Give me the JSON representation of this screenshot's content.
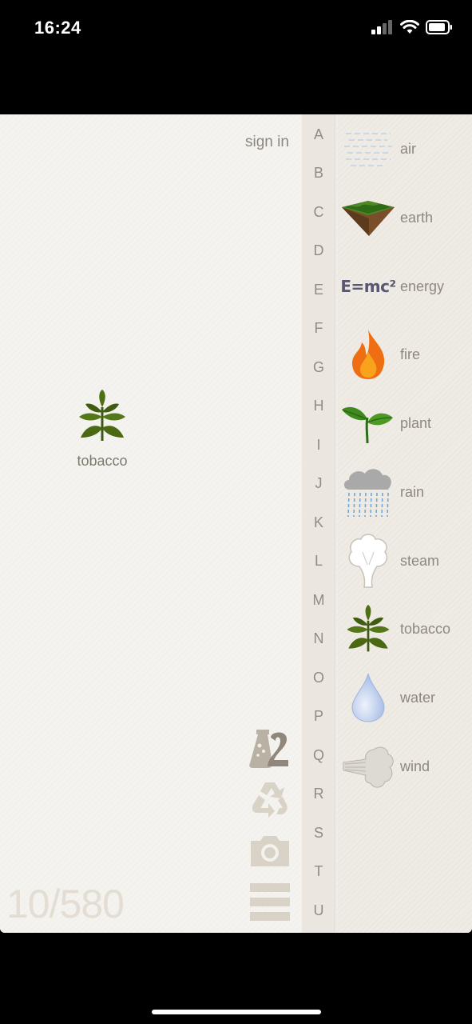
{
  "status_bar": {
    "time": "16:24"
  },
  "header": {
    "sign_in": "sign in"
  },
  "canvas": {
    "items": [
      {
        "label": "tobacco",
        "icon": "tobacco-leaf-icon"
      }
    ]
  },
  "counter": "10/580",
  "tools": [
    "alchemy-2-icon",
    "recycle-icon",
    "camera-icon",
    "menu-icon"
  ],
  "alphabet": [
    "A",
    "B",
    "C",
    "D",
    "E",
    "F",
    "G",
    "H",
    "I",
    "J",
    "K",
    "L",
    "M",
    "N",
    "O",
    "P",
    "Q",
    "R",
    "S",
    "T",
    "U"
  ],
  "elements": [
    {
      "label": "air",
      "icon": "air-icon"
    },
    {
      "label": "earth",
      "icon": "earth-icon"
    },
    {
      "label": "energy",
      "icon": "energy-icon",
      "icon_text": "E=mc²"
    },
    {
      "label": "fire",
      "icon": "fire-icon"
    },
    {
      "label": "plant",
      "icon": "plant-icon"
    },
    {
      "label": "rain",
      "icon": "rain-icon"
    },
    {
      "label": "steam",
      "icon": "steam-icon"
    },
    {
      "label": "tobacco",
      "icon": "tobacco-icon"
    },
    {
      "label": "water",
      "icon": "water-drop-icon"
    },
    {
      "label": "wind",
      "icon": "wind-icon"
    }
  ],
  "colors": {
    "background": "#f4f2ee",
    "text": "#8f887e",
    "tool": "#d9d2c6"
  }
}
